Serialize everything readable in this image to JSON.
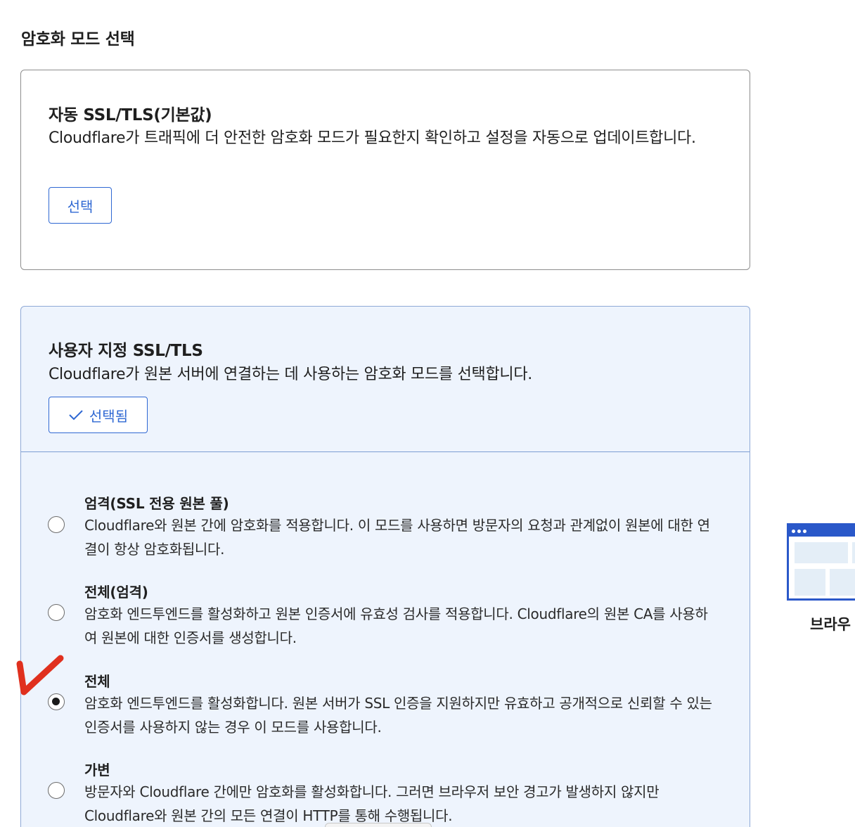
{
  "section_title": "암호화 모드 선택",
  "auto_card": {
    "title": "자동 SSL/TLS(기본값)",
    "description": "Cloudflare가 트래픽에 더 안전한 암호화 모드가 필요한지 확인하고 설정을 자동으로 업데이트합니다.",
    "button_label": "선택"
  },
  "custom_card": {
    "title": "사용자 지정 SSL/TLS",
    "description": "Cloudflare가 원본 서버에 연결하는 데 사용하는 암호화 모드를 선택합니다.",
    "button_label": "선택됨",
    "options": [
      {
        "title": "엄격(SSL 전용 원본 풀)",
        "description": "Cloudflare와 원본 간에 암호화를 적용합니다. 이 모드를 사용하면 방문자의 요청과 관계없이 원본에 대한 연결이 항상 암호화됩니다.",
        "selected": false
      },
      {
        "title": "전체(엄격)",
        "description": "암호화 엔드투엔드를 활성화하고 원본 인증서에 유효성 검사를 적용합니다. Cloudflare의 원본 CA를 사용하여 원본에 대한 인증서를 생성합니다.",
        "selected": false
      },
      {
        "title": "전체",
        "description": "암호화 엔드투엔드를 활성화합니다. 원본 서버가 SSL 인증을 지원하지만 유효하고 공개적으로 신뢰할 수 있는 인증서를 사용하지 않는 경우 이 모드를 사용합니다.",
        "selected": true
      },
      {
        "title": "가변",
        "description": "방문자와 Cloudflare 간에만 암호화를 활성화합니다. 그러면 브라우저 보안 경고가 발생하지 않지만 Cloudflare와 원본 간의 모든 연결이 HTTP를 통해 수행됩니다.",
        "selected": false
      }
    ]
  },
  "side_illustration": {
    "label": "브라우"
  },
  "icons": {
    "check": "checkmark-icon",
    "annotation": "red-checkmark-annotation-icon",
    "browser": "browser-window-icon"
  },
  "colors": {
    "accent": "#2f68d3",
    "custom_card_bg": "#eef4fd",
    "annotation_red": "#e0301e",
    "browser_blue": "#2a58c9"
  }
}
